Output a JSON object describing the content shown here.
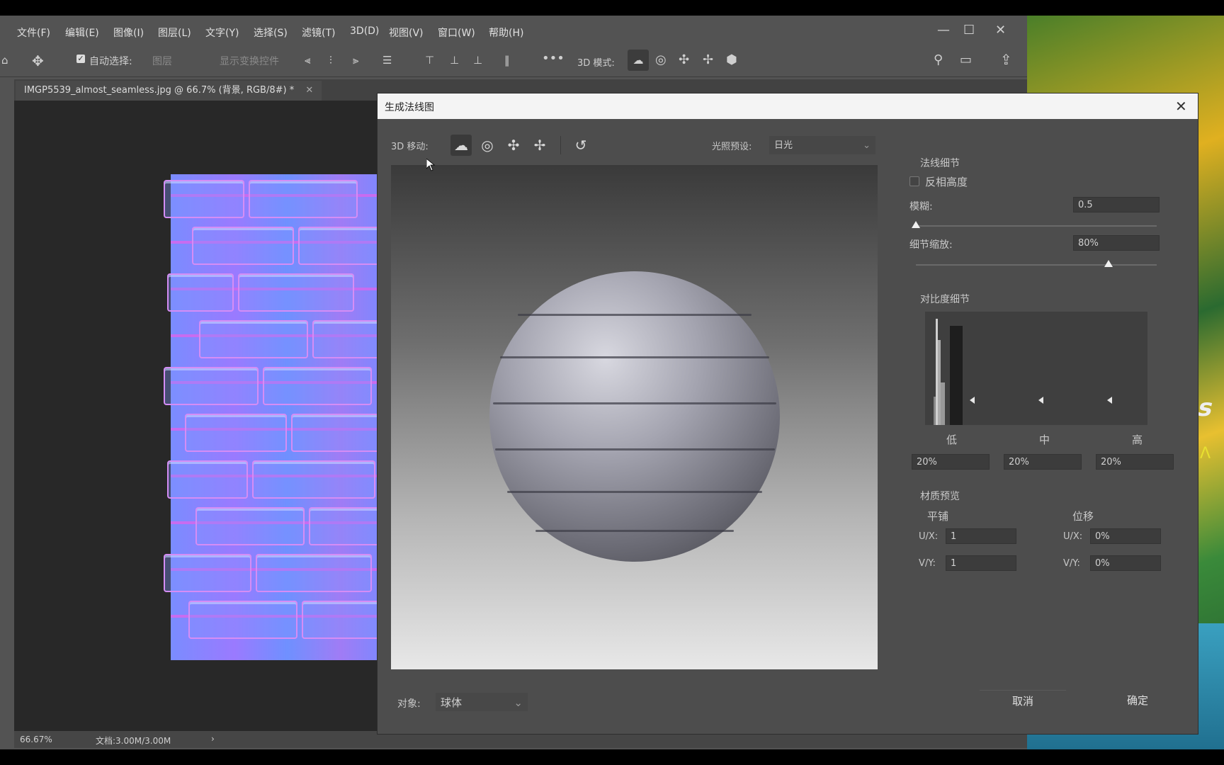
{
  "menu": {
    "items": [
      "文件(F)",
      "编辑(E)",
      "图像(I)",
      "图层(L)",
      "文字(Y)",
      "选择(S)",
      "滤镜(T)",
      "3D(D)",
      "视图(V)",
      "窗口(W)",
      "帮助(H)"
    ]
  },
  "options": {
    "auto_select_label": "自动选择:",
    "auto_select_value": "图层",
    "show_transform": "显示变换控件",
    "mode_3d_label": "3D 模式:"
  },
  "document": {
    "tab_title": "IMGP5539_almost_seamless.jpg @ 66.7% (背景, RGB/8#) *",
    "zoom": "66.67%",
    "doc_info": "文档:3.00M/3.00M"
  },
  "dialog": {
    "title": "生成法线图",
    "move_3d_label": "3D 移动:",
    "light_preset_label": "光照预设:",
    "light_preset_value": "日光",
    "normal_detail": {
      "heading": "法线细节",
      "invert_height_label": "反相高度",
      "invert_height_checked": false,
      "blur_label": "模糊:",
      "blur_value": "0.5",
      "blur_level": 0.0,
      "detail_scale_label": "细节缩放:",
      "detail_scale_value": "80%",
      "detail_scale_level": 0.8
    },
    "contrast_detail": {
      "heading": "对比度细节",
      "low_label": "低",
      "mid_label": "中",
      "high_label": "高",
      "low_value": "20%",
      "mid_value": "20%",
      "high_value": "20%"
    },
    "material_preview": {
      "heading": "材质预览",
      "tile_label": "平铺",
      "offset_label": "位移",
      "tile_ux_label": "U/X:",
      "tile_ux_value": "1",
      "tile_vy_label": "V/Y:",
      "tile_vy_value": "1",
      "offset_ux_label": "U/X:",
      "offset_ux_value": "0%",
      "offset_vy_label": "V/Y:",
      "offset_vy_value": "0%"
    },
    "object_label": "对象:",
    "object_value": "球体",
    "cancel_label": "取消",
    "ok_label": "确定"
  }
}
